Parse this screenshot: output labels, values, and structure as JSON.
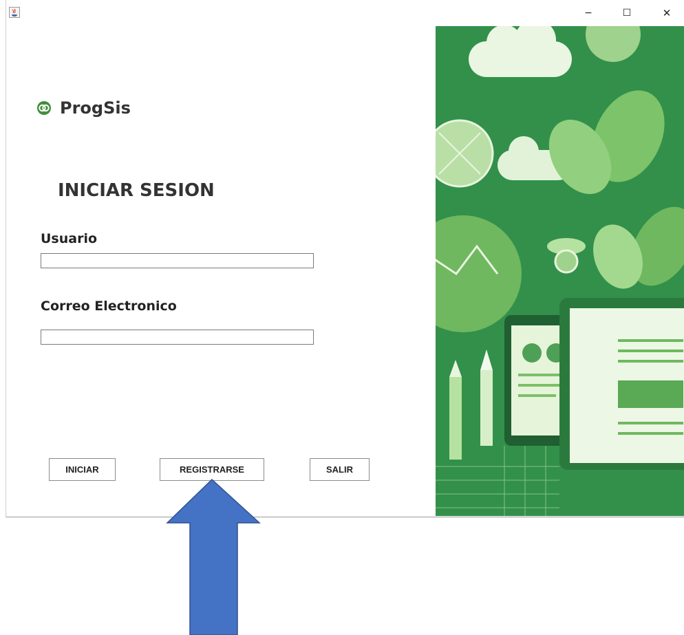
{
  "window": {
    "controls": {
      "minimize": "−",
      "maximize": "☐",
      "close": "✕"
    }
  },
  "brand": {
    "name": "ProgSis",
    "logo_icon": "rings-logo-icon"
  },
  "form": {
    "heading": "INICIAR SESION",
    "usuario_label": "Usuario",
    "usuario_value": "",
    "correo_label": "Correo Electronico",
    "correo_value": ""
  },
  "buttons": {
    "iniciar": "INICIAR",
    "registrarse": "REGISTRARSE",
    "salir": "SALIR"
  },
  "colors": {
    "art_dark_green": "#2e8b45",
    "art_light_green": "#c8e6b8",
    "annotation_arrow": "#4472c4"
  }
}
